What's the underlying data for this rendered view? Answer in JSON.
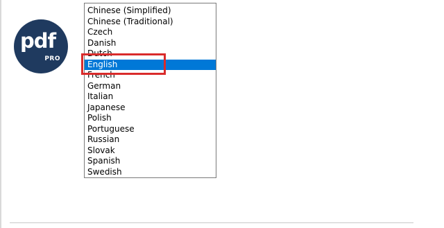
{
  "logo": {
    "main_text": "pdf",
    "sub_text": "PRO",
    "color": "#1f3a5f"
  },
  "language_list": {
    "selected": "English",
    "selected_color": "#0078d7",
    "highlight_color": "#d92b2b",
    "items": [
      "Chinese (Simplified)",
      "Chinese (Traditional)",
      "Czech",
      "Danish",
      "Dutch",
      "English",
      "French",
      "German",
      "Italian",
      "Japanese",
      "Polish",
      "Portuguese",
      "Russian",
      "Slovak",
      "Spanish",
      "Swedish"
    ]
  }
}
